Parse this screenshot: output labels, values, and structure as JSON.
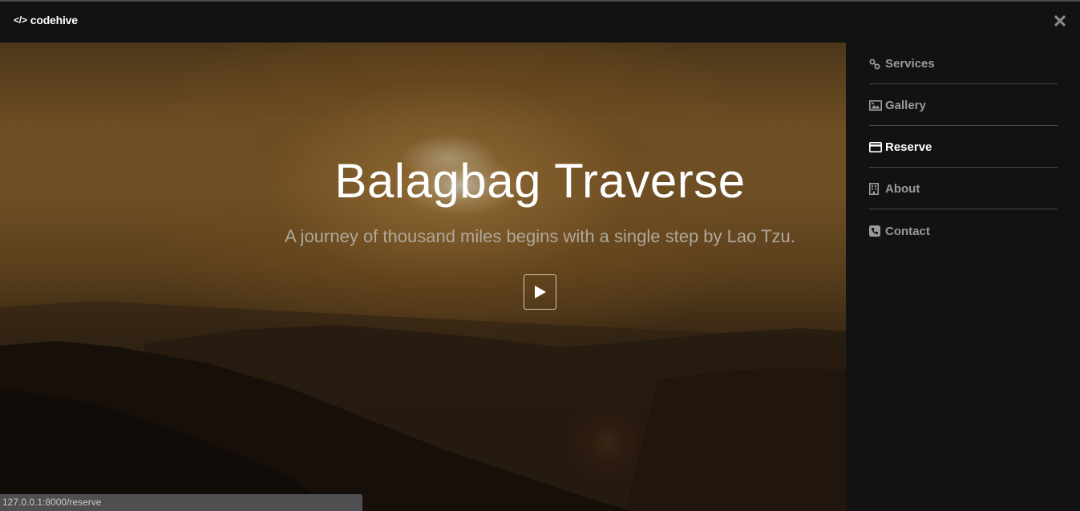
{
  "header": {
    "brand_icon": "</>",
    "brand_label": "codehive",
    "close_icon": "close-icon"
  },
  "hero": {
    "title": "Balagbag Traverse",
    "subtitle": "A journey of thousand miles begins with a single step by Lao Tzu.",
    "play_icon": "play-icon"
  },
  "sidebar": {
    "items": [
      {
        "label": "Services",
        "icon": "link-icon",
        "active": false
      },
      {
        "label": "Gallery",
        "icon": "image-icon",
        "active": false
      },
      {
        "label": "Reserve",
        "icon": "credit-card-icon",
        "active": true
      },
      {
        "label": "About",
        "icon": "building-icon",
        "active": false
      },
      {
        "label": "Contact",
        "icon": "phone-icon",
        "active": false
      }
    ]
  },
  "statusbar": {
    "url": "127.0.0.1:8000/reserve"
  },
  "colors": {
    "background": "#121212",
    "active_text": "#ffffff",
    "inactive_text": "#9a9a9a",
    "divider": "#4a4a4a"
  }
}
